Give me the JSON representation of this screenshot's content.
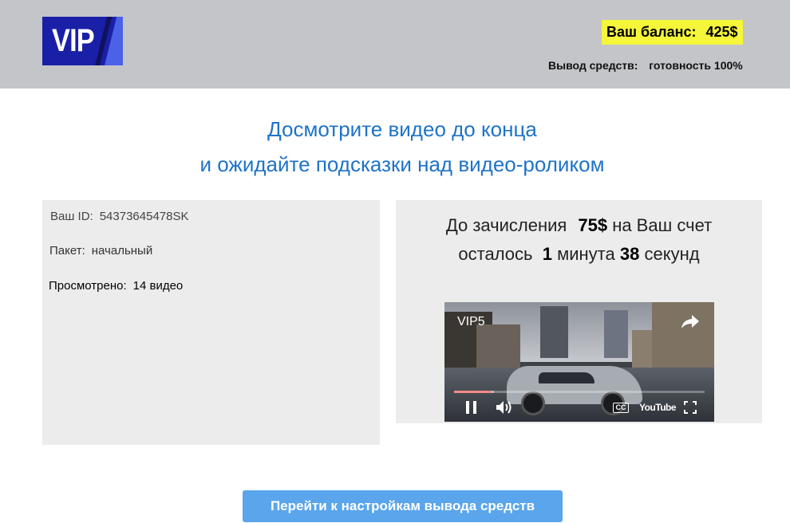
{
  "header": {
    "logo_text": "VIP",
    "balance_label": "Ваш баланс:",
    "balance_value": "425$",
    "withdraw_label": "Вывод средств:",
    "withdraw_value": "готовность 100%",
    "balance_bg": "#f5f53a"
  },
  "headline": {
    "line1": "Досмотрите видео до конца",
    "line2": "и ожидайте подсказки над видео-роликом",
    "color": "#1e73c8"
  },
  "profile": {
    "id_label": "Ваш ID:",
    "id_value": "54373645478SK",
    "package_label": "Пакет:",
    "package_value": "начальный",
    "viewed_label": "Просмотрено:",
    "viewed_value": "14 видео"
  },
  "countdown": {
    "prefix": "До зачисления",
    "amount": "75$",
    "suffix": "на Ваш счет",
    "remaining_label": "осталось",
    "minutes_value": "1",
    "minutes_label": "минута",
    "seconds_value": "38",
    "seconds_label": "секунд"
  },
  "video": {
    "title": "VIP5",
    "brand": "YouTube",
    "cc_label": "CC",
    "progress_fraction": 0.15,
    "buffer_fraction": 0.16,
    "icons": [
      "share-icon",
      "pause-icon",
      "volume-icon",
      "cc-icon",
      "settings-icon",
      "fullscreen-icon"
    ]
  },
  "action": {
    "button_label": "Перейти к настройкам вывода средств",
    "button_color": "#5aa5ec"
  }
}
